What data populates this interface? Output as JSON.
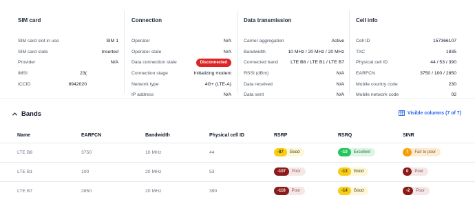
{
  "sim": {
    "title": "SIM card",
    "rows": [
      {
        "k": "SIM card slot in use",
        "v": "SIM 1"
      },
      {
        "k": "SIM card state",
        "v": "Inserted"
      },
      {
        "k": "Provider",
        "v": "N/A"
      },
      {
        "k": "IMSI",
        "v": "23("
      },
      {
        "k": "ICCID",
        "v": "8942020"
      }
    ]
  },
  "connection": {
    "title": "Connection",
    "rows": [
      {
        "k": "Operator",
        "v": "N/A"
      },
      {
        "k": "Operator state",
        "v": "N/A"
      },
      {
        "k": "Data connection state",
        "v": "Disconnected"
      },
      {
        "k": "Connection stage",
        "v": "Initializing modem"
      },
      {
        "k": "Network type",
        "v": "4G+ (LTE-A)"
      },
      {
        "k": "IP address",
        "v": "N/A"
      }
    ]
  },
  "data": {
    "title": "Data transmission",
    "rows": [
      {
        "k": "Carrier aggregation",
        "v": "Active"
      },
      {
        "k": "Bandwidth",
        "v": "10 MHz / 20 MHz / 20 MHz"
      },
      {
        "k": "Connected band",
        "v": "LTE B8 / LTE B1 / LTE B7"
      },
      {
        "k": "RSSI (dBm)",
        "v": "N/A"
      },
      {
        "k": "Data received",
        "v": "N/A"
      },
      {
        "k": "Data sent",
        "v": "N/A"
      }
    ]
  },
  "cell": {
    "title": "Cell info",
    "rows": [
      {
        "k": "Cell ID",
        "v": "157366107"
      },
      {
        "k": "TAC",
        "v": "1835"
      },
      {
        "k": "Physical cell ID",
        "v": "44 / 53 / 390"
      },
      {
        "k": "EARFCN",
        "v": "3750 / 100 / 2850"
      },
      {
        "k": "Mobile country code",
        "v": "230"
      },
      {
        "k": "Mobile network code",
        "v": "02"
      }
    ]
  },
  "bands": {
    "title": "Bands",
    "visible_columns": "Visible columns (7 of 7)",
    "columns": [
      "Name",
      "EARFCN",
      "Bandwidth",
      "Physical cell ID",
      "RSRP",
      "RSRQ",
      "SINR"
    ],
    "rows": [
      {
        "name": "LTE B8",
        "earfcn": "3750",
        "bandwidth": "10 MHz",
        "pci": "44",
        "rsrp": {
          "n": "-87",
          "t": "Good"
        },
        "rsrq": {
          "n": "-10",
          "t": "Excellent"
        },
        "sinr": {
          "n": "7",
          "t": "Fair to poor"
        }
      },
      {
        "name": "LTE B1",
        "earfcn": "100",
        "bandwidth": "20 MHz",
        "pci": "53",
        "rsrp": {
          "n": "-107",
          "t": "Poor"
        },
        "rsrq": {
          "n": "-13",
          "t": "Good"
        },
        "sinr": {
          "n": "0",
          "t": "Poor"
        }
      },
      {
        "name": "LTE B7",
        "earfcn": "2850",
        "bandwidth": "20 MHz",
        "pci": "390",
        "rsrp": {
          "n": "-116",
          "t": "Poor"
        },
        "rsrq": {
          "n": "-14",
          "t": "Good"
        },
        "sinr": {
          "n": "-2",
          "t": "Poor"
        }
      }
    ]
  }
}
